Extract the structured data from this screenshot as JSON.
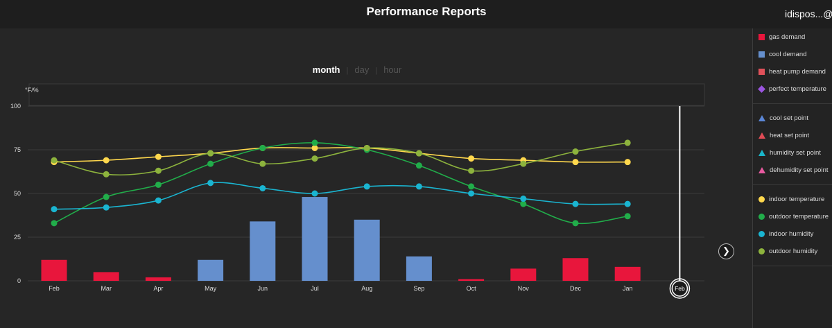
{
  "header": {
    "title": "Performance Reports",
    "user": "idispos...@g"
  },
  "tabs": [
    {
      "label": "month",
      "active": true
    },
    {
      "label": "day",
      "active": false
    },
    {
      "label": "hour",
      "active": false
    }
  ],
  "legend": {
    "groups": [
      [
        {
          "label": "gas demand",
          "color": "#e8163c",
          "shape": "square"
        },
        {
          "label": "cool demand",
          "color": "#658fcd",
          "shape": "square"
        },
        {
          "label": "heat pump demand",
          "color": "#e0515a",
          "shape": "square"
        },
        {
          "label": "perfect temperature",
          "color": "#9b55e0",
          "shape": "diamond"
        }
      ],
      [
        {
          "label": "cool set point",
          "color": "#5b86d6",
          "shape": "triangle"
        },
        {
          "label": "heat set point",
          "color": "#e04b55",
          "shape": "triangle"
        },
        {
          "label": "humidity set point",
          "color": "#1ab5c9",
          "shape": "triangle"
        },
        {
          "label": "dehumidity set point",
          "color": "#e85aa0",
          "shape": "triangle"
        }
      ],
      [
        {
          "label": "indoor temperature",
          "color": "#ffd84d",
          "shape": "circle"
        },
        {
          "label": "outdoor temperature",
          "color": "#21ad4a",
          "shape": "circle"
        },
        {
          "label": "indoor humidity",
          "color": "#1ab5d1",
          "shape": "circle"
        },
        {
          "label": "outdoor humidity",
          "color": "#8db33d",
          "shape": "circle"
        }
      ]
    ]
  },
  "next_icon": "chevron-right-icon",
  "chart_data": {
    "type": "bar",
    "ylabel": "°F/%",
    "ylim": [
      0,
      100
    ],
    "yticks": [
      0,
      25,
      50,
      75,
      100
    ],
    "grid": true,
    "legend_position": "right",
    "categories": [
      "Feb",
      "Mar",
      "Apr",
      "May",
      "Jun",
      "Jul",
      "Aug",
      "Sep",
      "Oct",
      "Nov",
      "Dec",
      "Jan"
    ],
    "current_marker": "Feb",
    "bar_series": [
      {
        "name": "gas demand",
        "color": "#e8163c",
        "values": [
          12,
          5,
          2,
          null,
          null,
          null,
          null,
          null,
          1,
          7,
          13,
          8
        ]
      },
      {
        "name": "cool demand",
        "color": "#658fcd",
        "values": [
          null,
          null,
          null,
          12,
          34,
          48,
          35,
          14,
          null,
          null,
          null,
          null
        ]
      }
    ],
    "line_series": [
      {
        "name": "indoor temperature",
        "color": "#ffd84d",
        "values": [
          68,
          69,
          71,
          73,
          76,
          76,
          76,
          73,
          70,
          69,
          68,
          68
        ]
      },
      {
        "name": "outdoor temperature",
        "color": "#21ad4a",
        "values": [
          33,
          48,
          55,
          67,
          76,
          79,
          75,
          66,
          54,
          44,
          33,
          37
        ]
      },
      {
        "name": "indoor humidity",
        "color": "#1ab5d1",
        "values": [
          41,
          42,
          46,
          56,
          53,
          50,
          54,
          54,
          50,
          47,
          44,
          44
        ]
      },
      {
        "name": "outdoor humidity",
        "color": "#8db33d",
        "values": [
          69,
          61,
          63,
          73,
          67,
          70,
          76,
          73,
          63,
          67,
          74,
          79
        ]
      }
    ]
  }
}
